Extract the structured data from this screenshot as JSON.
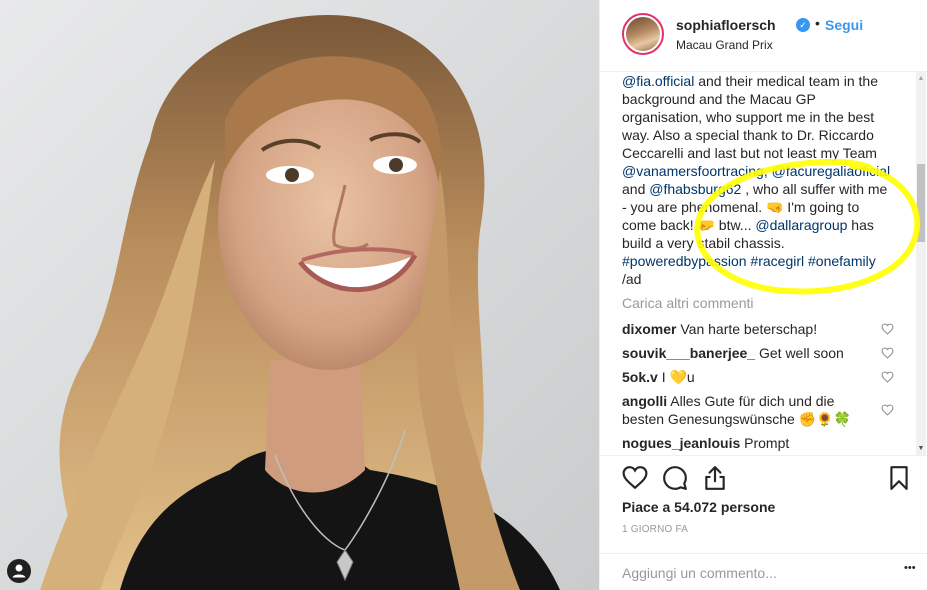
{
  "post": {
    "username": "sophiafloersch",
    "verified_glyph": "✓",
    "separator": "•",
    "follow_label": "Segui",
    "location": "Macau Grand Prix"
  },
  "caption": {
    "lines": [
      {
        "parts": [
          {
            "t": "@fia.official",
            "link": true
          },
          {
            "t": " and their medical team in the",
            "link": false
          }
        ]
      },
      {
        "parts": [
          {
            "t": "background and the Macau GP",
            "link": false
          }
        ]
      },
      {
        "parts": [
          {
            "t": "organisation, who support me in the best",
            "link": false
          }
        ]
      },
      {
        "parts": [
          {
            "t": "way. Also a special thank to Dr. Riccardo",
            "link": false
          }
        ]
      },
      {
        "parts": [
          {
            "t": "Ceccarelli and last but not least my Team",
            "link": false
          }
        ]
      },
      {
        "parts": [
          {
            "t": "@vanamersfoortracing",
            "link": true
          },
          {
            "t": ", ",
            "link": false
          },
          {
            "t": "@facuregaliaoficial",
            "link": true
          }
        ]
      },
      {
        "parts": [
          {
            "t": "and ",
            "link": false
          },
          {
            "t": "@fhabsburg62",
            "link": true
          },
          {
            "t": " , who all suffer with me",
            "link": false
          }
        ]
      },
      {
        "parts": [
          {
            "t": "- you are phenomenal. 🤜 I'm going to",
            "link": false
          }
        ]
      },
      {
        "parts": [
          {
            "t": "come back! 🤛 btw... ",
            "link": false
          },
          {
            "t": "@dallaragroup",
            "link": true
          },
          {
            "t": " has",
            "link": false
          }
        ]
      },
      {
        "parts": [
          {
            "t": "build a very stabil chassis.",
            "link": false
          }
        ]
      },
      {
        "parts": [
          {
            "t": "#poweredbypassion",
            "link": true
          },
          {
            "t": " ",
            "link": false
          },
          {
            "t": "#racegirl",
            "link": true
          },
          {
            "t": " ",
            "link": false
          },
          {
            "t": "#onefamily",
            "link": true
          }
        ]
      },
      {
        "parts": [
          {
            "t": "/ad",
            "link": false
          }
        ]
      }
    ]
  },
  "load_more_label": "Carica altri commenti",
  "comments": [
    {
      "user": "dixomer",
      "text": "Van harte beterschap!"
    },
    {
      "user": "souvik___banerjee_",
      "text": "Get well soon"
    },
    {
      "user": "5ok.v",
      "text": "I 💛u"
    },
    {
      "user": "angolli",
      "text": "Alles Gute für dich und die besten Genesungswünsche ✊🌻🍀"
    },
    {
      "user": "nogues_jeanlouis",
      "text": "Prompt"
    }
  ],
  "scroll_glyphs": {
    "up": "▲",
    "down": "▼"
  },
  "likes_text": "Piace a 54.072 persone",
  "timestamp": "1 GIORNO FA",
  "comment_placeholder": "Aggiungi un commento...",
  "more_glyph": "•••",
  "icons": [
    "heart-icon",
    "comment-icon",
    "share-icon",
    "bookmark-icon",
    "user-tag-icon",
    "verified-icon"
  ],
  "colors": {
    "link": "#003569",
    "follow": "#3897f0",
    "highlight": "#ffff00",
    "muted": "#999999"
  }
}
